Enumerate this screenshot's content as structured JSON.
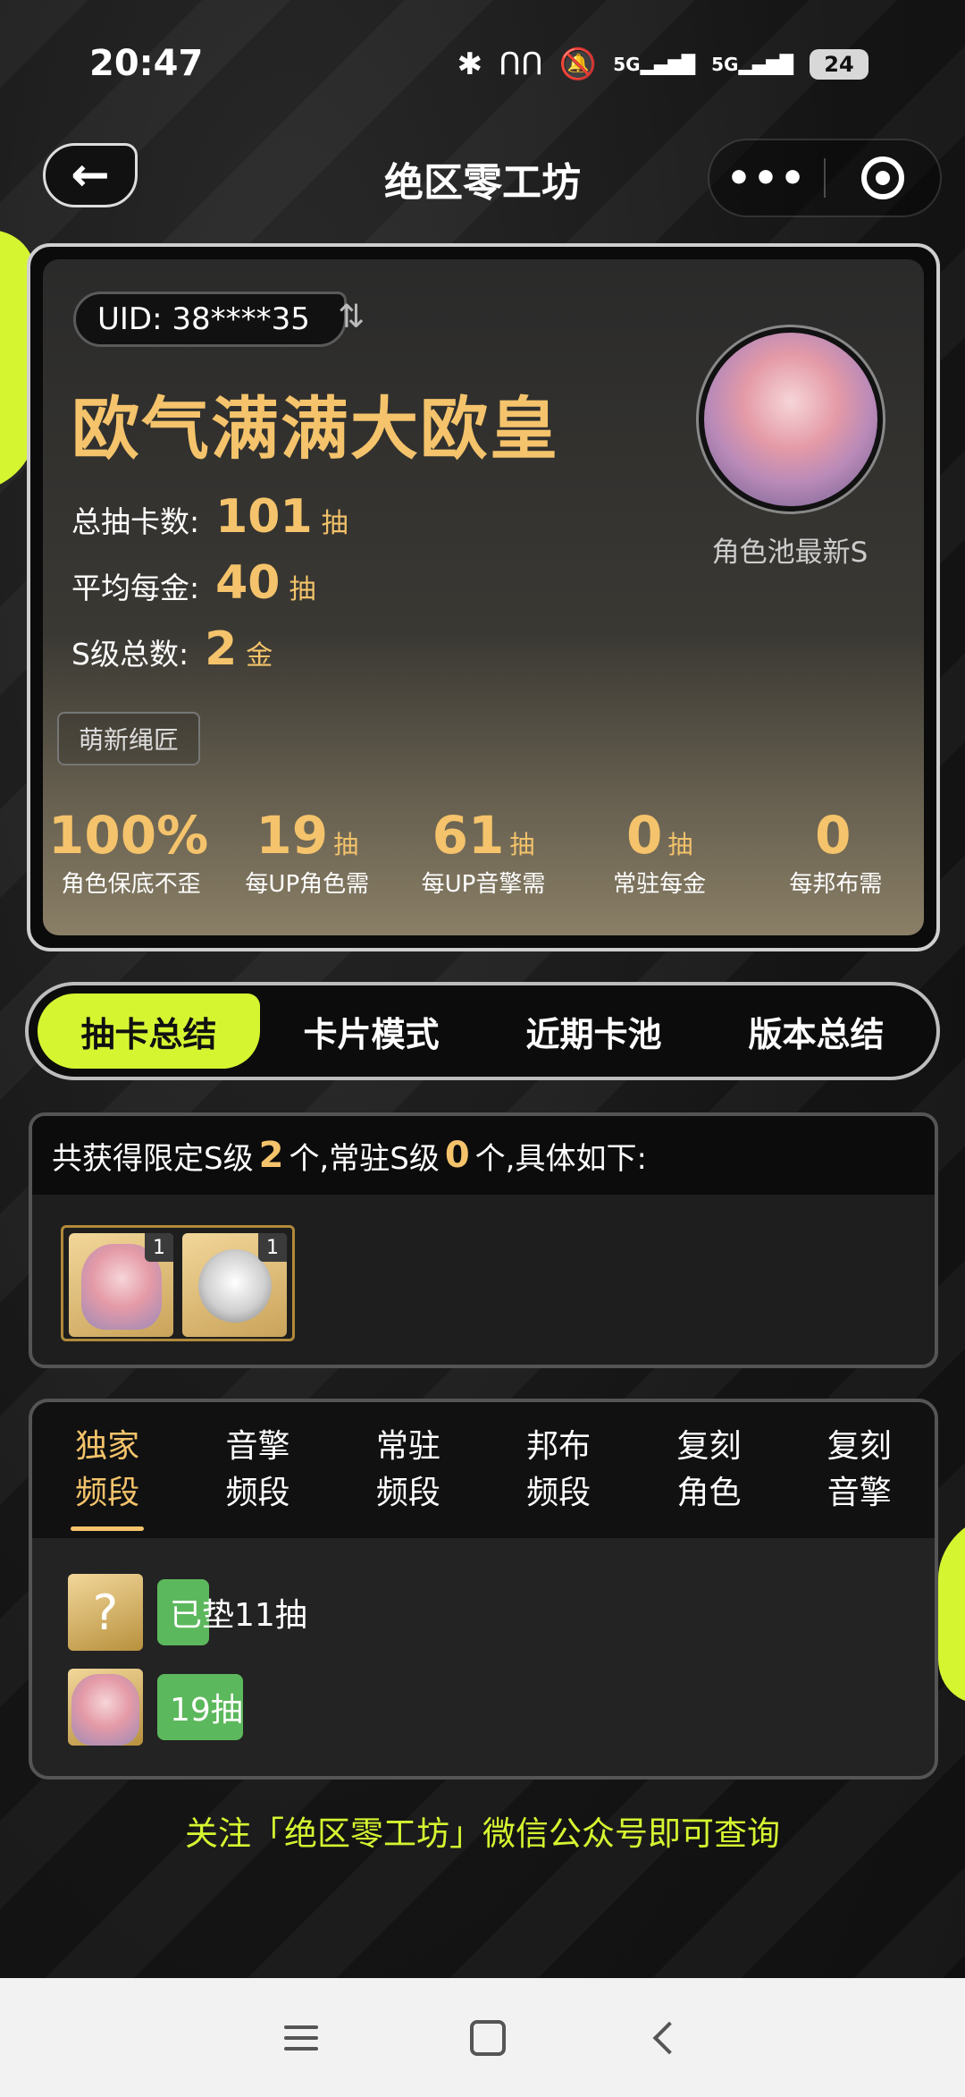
{
  "status_bar": {
    "time": "20:47",
    "signal_1": "5G",
    "signal_2": "5G",
    "battery": "24"
  },
  "nav": {
    "title": "绝区零工坊",
    "more": "•••"
  },
  "profile": {
    "uid": "UID: 38****35",
    "title": "欧气满满大欧皇",
    "stats": [
      {
        "label": "总抽卡数:",
        "value": "101",
        "unit": "抽"
      },
      {
        "label": "平均每金:",
        "value": "40",
        "unit": "抽"
      },
      {
        "label": "S级总数:",
        "value": "2",
        "unit": "金"
      }
    ],
    "rank_badge": "萌新绳匠",
    "avatar_caption": "角色池最新S",
    "metrics": [
      {
        "value": "100%",
        "unit": "",
        "label": "角色保底不歪"
      },
      {
        "value": "19",
        "unit": "抽",
        "label": "每UP角色需"
      },
      {
        "value": "61",
        "unit": "抽",
        "label": "每UP音擎需"
      },
      {
        "value": "0",
        "unit": "抽",
        "label": "常驻每金"
      },
      {
        "value": "0",
        "unit": "",
        "label": "每邦布需"
      }
    ]
  },
  "tabs": [
    "抽卡总结",
    "卡片模式",
    "近期卡池",
    "版本总结"
  ],
  "summary": {
    "prefix": "共获得限定S级",
    "limited_count": "2",
    "middle": "个,常驻S级",
    "standard_count": "0",
    "suffix": "个,具体如下:",
    "items": [
      {
        "name": "character",
        "count": "1"
      },
      {
        "name": "w-engine",
        "count": "1"
      }
    ]
  },
  "pity": {
    "tabs": [
      {
        "line1": "独家",
        "line2": "频段"
      },
      {
        "line1": "音擎",
        "line2": "频段"
      },
      {
        "line1": "常驻",
        "line2": "频段"
      },
      {
        "line1": "邦布",
        "line2": "频段"
      },
      {
        "line1": "复刻",
        "line2": "角色"
      },
      {
        "line1": "复刻",
        "line2": "音擎"
      }
    ],
    "rows": [
      {
        "icon": "?",
        "text": "已垫11抽",
        "fill": 0.18
      },
      {
        "icon": "",
        "text": "19抽",
        "fill": 0.3
      }
    ]
  },
  "footer_note": "关注「绝区零工坊」微信公众号即可查询"
}
